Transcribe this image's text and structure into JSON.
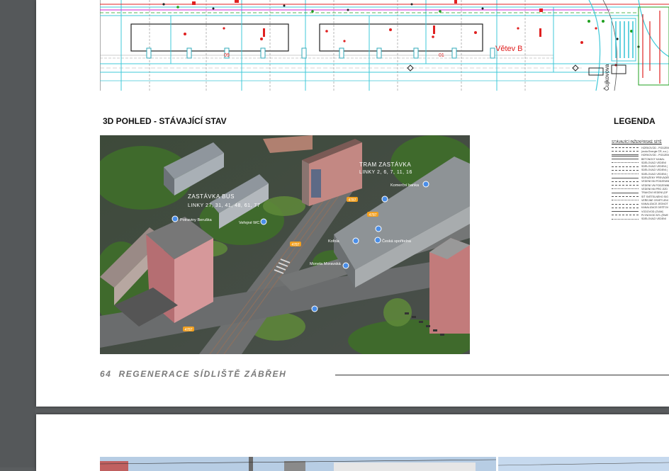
{
  "plan": {
    "branch_label": "Větev B",
    "street_label": "Čujkovova",
    "numbers": [
      "09",
      "01"
    ]
  },
  "section": {
    "title": "3D POHLED - STÁVAJÍCÍ STAV",
    "legend_title": "LEGENDA"
  },
  "photo_labels": {
    "tram_stop": "TRAM ZASTÁVKA",
    "tram_lines": "LINKY 2, 6, 7, 11, 16",
    "bus_stop": "ZASTÁVKA BUS",
    "bus_lines": "LINKY 27, 31, 41, 48, 61, 77",
    "poi_beruska": "Potraviny Beruška",
    "poi_verenske": "Veřejné WC",
    "poi_kofola": "Kofola",
    "poi_moravska": "Moneta Moravská",
    "poi_ceska_sporitelna": "Česká spořitelna",
    "poi_komercni": "Komerční banka",
    "road_badge": "4787"
  },
  "legend": {
    "heading": "STÁVAJÍCÍ INŽENÝRSKÉ SÍTĚ",
    "items": [
      "HORKOVOD - PODZEMNÍ",
      "(mola Energie ČR, a.s.)",
      "HORKOVOD - PODZEMNÍ",
      "BETONOVÝ KANÁL",
      "SDĚLOVACÍ VEDENÍ",
      "SDĚLOVACÍ VEDENÍ (",
      "SDĚLOVACÍ VEDENÍ (",
      "SDĚLOVACÍ VEDENÍ (",
      "SDRUŽENÝ PŘEVÁDĚN",
      "VEDENÍ NN PODZEMNÍ",
      "VEDENÍ VN PODZEMNÍ",
      "VEDENÍ NN PRO JÍZD",
      "TRAKČNÍ VEDENÍ (DP",
      "SÍŤ SVĚTELNÉHO SIG",
      "VEŘEJNÉ OSVĚTLENÍ",
      "KANALIZACE JEDNOT",
      "KANALIZACE DEŠŤOV",
      "VODOVOD (OVAK)",
      "PLYNOVOD NTL (RWE",
      "SDĚLOVACÍ VEDENÍ"
    ]
  },
  "footer": {
    "page_number": "64",
    "document_title": "REGENERACE SÍDLIŠTĚ ZÁBŘEH"
  },
  "colors": {
    "background": "#5a5d5f",
    "page": "#ffffff",
    "footer_text": "#7a7a7a",
    "plan_cyan": "#3fc8d8",
    "plan_red": "#e02020",
    "plan_magenta": "#d020d0",
    "plan_green": "#20a020"
  }
}
